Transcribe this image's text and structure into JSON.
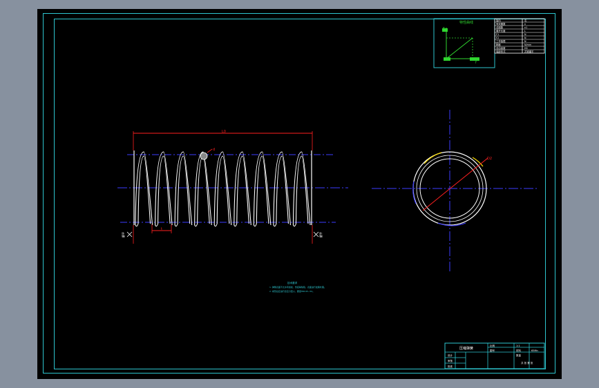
{
  "drawing": {
    "title": "压缩弹簧",
    "scale": "1:1",
    "material": "65Mn",
    "sheet_label": "共 张 第 张",
    "notes_title": "技术要求",
    "notes": [
      "1. 弹簧表面不允许有裂纹、伤痕等缺陷，表面进行发黑处理。",
      "2. 成形后应进行去应力回火，硬度HRC45~50。"
    ],
    "dims": {
      "free_length": "L0",
      "pitch": "t",
      "wire_dia": "d",
      "outer_dia": "D2"
    },
    "end_labels": {
      "left": "磨平",
      "right": "磨平"
    }
  },
  "chart_panel": {
    "title": "特性曲线",
    "y_label": "F",
    "x_label": "f"
  },
  "param_table": {
    "rows": [
      [
        "旋向",
        "右"
      ],
      [
        "有效圈数",
        "n"
      ],
      [
        "总圈数",
        "n1"
      ],
      [
        "展开长度",
        "L"
      ],
      [
        "F1",
        "N"
      ],
      [
        "F2",
        "N"
      ],
      [
        "工作极限",
        "N"
      ],
      [
        "刚度",
        "N/mm"
      ],
      [
        "自由高度",
        "H0"
      ],
      [
        "端部形式",
        "并紧磨平"
      ]
    ]
  },
  "title_block": {
    "name": "压缩弹簧",
    "rows": [
      "设计",
      "审核",
      "批准"
    ],
    "right_cells": [
      "比例",
      "1:1",
      "图号",
      "材料",
      "65Mn",
      "数量"
    ]
  }
}
